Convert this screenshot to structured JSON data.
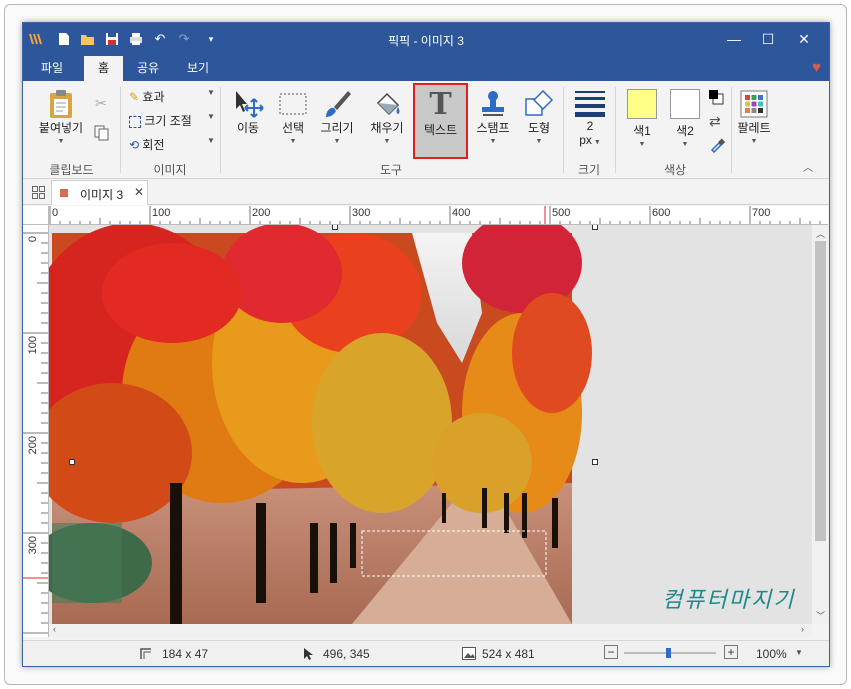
{
  "app": {
    "title": "픽픽 - 이미지 3",
    "accent": "#2d579a"
  },
  "menu_tabs": [
    "파일",
    "홈",
    "공유",
    "보기"
  ],
  "ribbon": {
    "clipboard": {
      "paste": "붙여넣기",
      "group": "클립보드"
    },
    "image": {
      "effects": "효과",
      "resize": "크기 조절",
      "rotate": "회전",
      "group": "이미지"
    },
    "tools": {
      "move": "이동",
      "select": "선택",
      "draw": "그리기",
      "fill": "채우기",
      "text": "텍스트",
      "stamp": "스탬프",
      "shape": "도형",
      "group": "도구"
    },
    "size": {
      "value": "2",
      "unit": "px",
      "group": "크기"
    },
    "color": {
      "color1": "색1",
      "color2": "색2",
      "group": "색상",
      "color1_value": "#ffff88",
      "color2_value": "#ffffff"
    },
    "palette": {
      "label": "팔레트"
    }
  },
  "doc_tab": {
    "name": "이미지 3"
  },
  "rulers": {
    "h_ticks": [
      "0",
      "100",
      "200",
      "300",
      "400",
      "500",
      "600",
      "700"
    ],
    "v_ticks": [
      "0",
      "100",
      "200",
      "300"
    ]
  },
  "watermark": "컴퓨터마지기",
  "status": {
    "selection_size": "184 x 47",
    "cursor_pos": "496, 345",
    "image_size": "524 x 481",
    "zoom": "100%"
  }
}
